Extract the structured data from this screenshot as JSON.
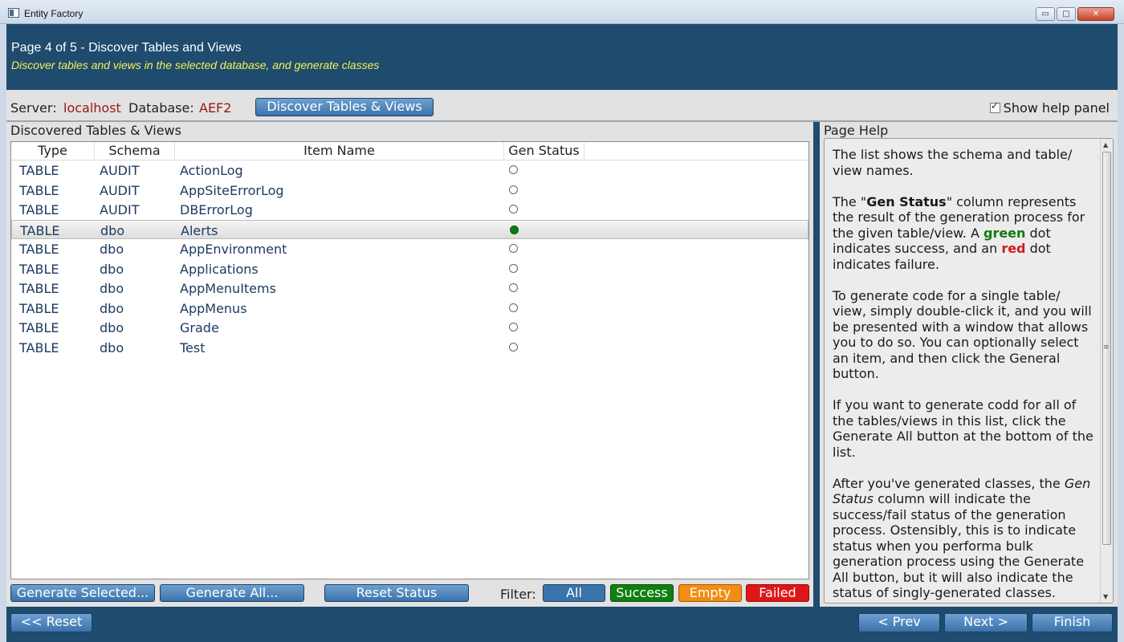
{
  "window": {
    "title": "Entity Factory",
    "buttons": [
      "▭",
      "□",
      "✕"
    ]
  },
  "header": {
    "title": "Page 4 of 5 - Discover Tables and Views",
    "subtitle": "Discover tables and views in the selected database, and generate classes"
  },
  "connection": {
    "server_label": "Server:",
    "server_value": "localhost",
    "database_label": "Database:",
    "database_value": "AEF2",
    "discover_button": "Discover Tables & Views",
    "show_help_label": "Show help panel",
    "show_help_checked": true
  },
  "list": {
    "label": "Discovered Tables & Views",
    "columns": [
      "Type",
      "Schema",
      "Item Name",
      "Gen Status"
    ],
    "rows": [
      {
        "type": "TABLE",
        "schema": "AUDIT",
        "name": "ActionLog",
        "status": "empty"
      },
      {
        "type": "TABLE",
        "schema": "AUDIT",
        "name": "AppSiteErrorLog",
        "status": "empty"
      },
      {
        "type": "TABLE",
        "schema": "AUDIT",
        "name": "DBErrorLog",
        "status": "empty"
      },
      {
        "type": "TABLE",
        "schema": "dbo",
        "name": "Alerts",
        "status": "success",
        "selected": true
      },
      {
        "type": "TABLE",
        "schema": "dbo",
        "name": "AppEnvironment",
        "status": "empty"
      },
      {
        "type": "TABLE",
        "schema": "dbo",
        "name": "Applications",
        "status": "empty"
      },
      {
        "type": "TABLE",
        "schema": "dbo",
        "name": "AppMenuItems",
        "status": "empty"
      },
      {
        "type": "TABLE",
        "schema": "dbo",
        "name": "AppMenus",
        "status": "empty"
      },
      {
        "type": "TABLE",
        "schema": "dbo",
        "name": "Grade",
        "status": "empty"
      },
      {
        "type": "TABLE",
        "schema": "dbo",
        "name": "Test",
        "status": "empty"
      }
    ]
  },
  "actions": {
    "generate_selected": "Generate Selected...",
    "generate_all": "Generate All...",
    "reset_status": "Reset Status",
    "filter_label": "Filter:",
    "filters": [
      {
        "label": "All",
        "color": "#3a73ab"
      },
      {
        "label": "Success",
        "color": "#0f7f10"
      },
      {
        "label": "Empty",
        "color": "#f38c12"
      },
      {
        "label": "Failed",
        "color": "#e01616"
      }
    ]
  },
  "help": {
    "title": "Page Help",
    "p1": "The list shows the schema and table/ view names.",
    "p2_a": "The \"",
    "p2_b": "Gen Status",
    "p2_c": "\" column represents the result of the generation process for the given table/view. A ",
    "p2_d": "green",
    "p2_e": " dot indicates success, and an ",
    "p2_f": "red",
    "p2_g": " dot indicates failure.",
    "p3": "To generate code for a single table/ view, simply double-click it, and you will be presented with a window that allows you to do so. You can optionally select an item, and then click the General button.",
    "p4": "If you want to generate codd for all of the tables/views in this list, click the Generate All button at the bottom of the list.",
    "p5_a": "After you've generated classes, the ",
    "p5_b": "Gen Status",
    "p5_c": " column will indicate the success/fail status of the generation process. Ostensibly, this is to indicate status when you performa bulk generation process using the Generate All button, but it will also indicate the status of singly-generated classes."
  },
  "footer": {
    "reset": "<< Reset",
    "prev": "< Prev",
    "next": "Next >",
    "finish": "Finish"
  },
  "colors": {
    "banner": "#1f4b6e",
    "accent_button": "#3a73ab",
    "success": "#0e7a0e",
    "failure": "#d31a1a",
    "subtitle": "#f3f157"
  }
}
